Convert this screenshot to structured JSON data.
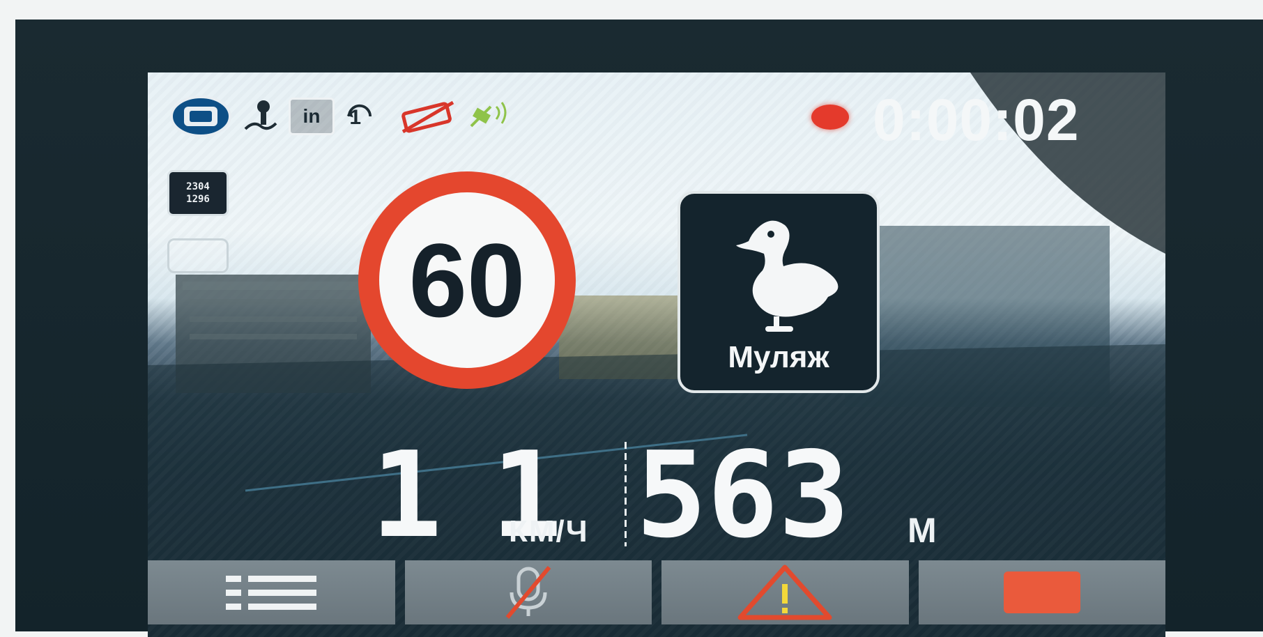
{
  "status_bar": {
    "icons": [
      "camera-icon",
      "gps-icon",
      "in-icon",
      "radar-count-icon",
      "mute-icon",
      "satellite-icon"
    ],
    "in_label": "in",
    "counter_label": "1",
    "recording": true,
    "rec_time": "0:00:02",
    "rec_color": "#e43a2c"
  },
  "side_badge": {
    "line1": "2304",
    "line2": "1296"
  },
  "speed_limit": {
    "value": "60",
    "ring_color": "#e4472e"
  },
  "alert": {
    "icon": "duck-icon",
    "label": "Муляж"
  },
  "speed": {
    "value": "11",
    "unit": "КМ/Ч"
  },
  "distance": {
    "value": "563",
    "unit": "М"
  },
  "toolbar": {
    "buttons": [
      "menu-icon",
      "mic-off-icon",
      "warning-icon",
      "stop-icon"
    ],
    "stop_color": "#ea5a3c"
  }
}
